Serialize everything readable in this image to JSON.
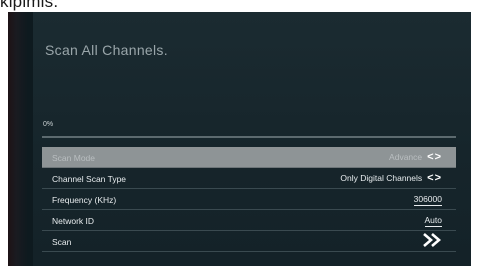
{
  "caption": "kipimis.",
  "screen": {
    "title": "Scan All Channels.",
    "progress": {
      "label": "0%",
      "value_percent": 0
    },
    "settings": [
      {
        "label": "Scan Mode",
        "value": "Advance",
        "control": "arrows",
        "selected": true
      },
      {
        "label": "Channel Scan Type",
        "value": "Only Digital Channels",
        "control": "arrows",
        "selected": false
      },
      {
        "label": "Frequency (KHz)",
        "value": "306000",
        "control": "underline",
        "selected": false
      },
      {
        "label": "Network ID",
        "value": "Auto",
        "control": "underline",
        "selected": false
      },
      {
        "label": "Scan",
        "value": "",
        "control": "double-chevron",
        "selected": false
      }
    ],
    "arrow_glyphs": "<>",
    "colors": {
      "background": "#16252b",
      "selected_row": "#8e9496",
      "text": "#e8ecee"
    }
  }
}
